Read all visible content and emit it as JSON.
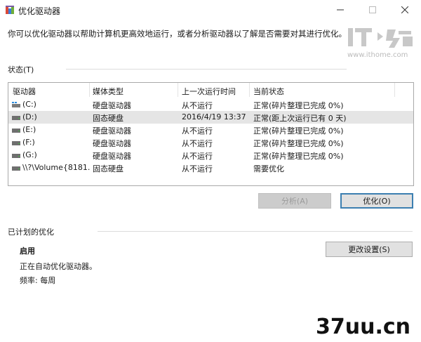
{
  "window": {
    "title": "优化驱动器"
  },
  "description": "你可以优化驱动器以帮助计算机更高效地运行，或者分析驱动器以了解是否需要对其进行优化。",
  "watermark": {
    "logo_text": "IT之家",
    "url": "www.ithome.com",
    "bottom": "37uu.cn"
  },
  "status": {
    "label": "状态(T)",
    "columns": [
      "驱动器",
      "媒体类型",
      "上一次运行时间",
      "当前状态"
    ],
    "rows": [
      {
        "drive": "(C:)",
        "media": "硬盘驱动器",
        "last_run": "从不运行",
        "status": "正常(碎片整理已完成 0%)",
        "icon": "windows-drive-icon"
      },
      {
        "drive": "(D:)",
        "media": "固态硬盘",
        "last_run": "2016/4/19 13:37",
        "status": "正常(距上次运行已有 0 天)",
        "icon": "drive-icon",
        "selected": true
      },
      {
        "drive": "(E:)",
        "media": "硬盘驱动器",
        "last_run": "从不运行",
        "status": "正常(碎片整理已完成 0%)",
        "icon": "drive-icon"
      },
      {
        "drive": "(F:)",
        "media": "硬盘驱动器",
        "last_run": "从不运行",
        "status": "正常(碎片整理已完成 0%)",
        "icon": "drive-icon"
      },
      {
        "drive": "(G:)",
        "media": "硬盘驱动器",
        "last_run": "从不运行",
        "status": "正常(碎片整理已完成 0%)",
        "icon": "drive-icon"
      },
      {
        "drive": "\\\\?\\Volume{8181...",
        "media": "固态硬盘",
        "last_run": "从不运行",
        "status": "需要优化",
        "icon": "drive-icon"
      }
    ]
  },
  "buttons": {
    "analyze": "分析(A)",
    "optimize": "优化(O)",
    "change_settings": "更改设置(S)"
  },
  "schedule": {
    "label": "已计划的优化",
    "state": "启用",
    "message": "正在自动优化驱动器。",
    "frequency": "频率: 每周"
  }
}
